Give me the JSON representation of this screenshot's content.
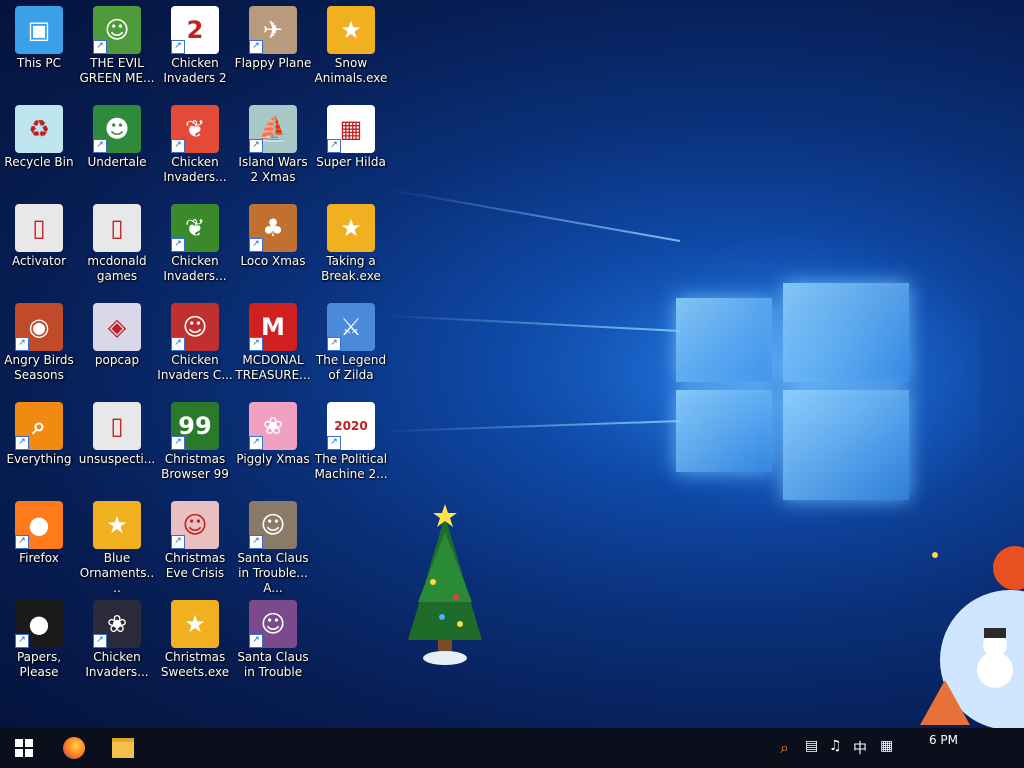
{
  "desktop": {
    "icons": [
      {
        "label": "This PC",
        "glyph": "▣",
        "bg": "#3aa0e8",
        "shortcut": false
      },
      {
        "label": "THE EVIL GREEN ME...",
        "glyph": "☺",
        "bg": "#4f9a3a",
        "shortcut": true
      },
      {
        "label": "Chicken Invaders 2",
        "glyph": "2",
        "bg": "#ffffff",
        "shortcut": true
      },
      {
        "label": "Flappy Plane",
        "glyph": "✈",
        "bg": "#b89a7c",
        "shortcut": true
      },
      {
        "label": "Snow Animals.exe",
        "glyph": "★",
        "bg": "#f0b020",
        "shortcut": false
      },
      {
        "label": "Recycle Bin",
        "glyph": "♻",
        "bg": "#bfe6ee",
        "shortcut": false
      },
      {
        "label": "Undertale",
        "glyph": "☻",
        "bg": "#2f8a3a",
        "shortcut": true
      },
      {
        "label": "Chicken Invaders...",
        "glyph": "❦",
        "bg": "#e34a3a",
        "shortcut": true
      },
      {
        "label": "Island Wars 2 Xmas",
        "glyph": "⛵",
        "bg": "#a8c8c8",
        "shortcut": true
      },
      {
        "label": "Super Hilda",
        "glyph": "▦",
        "bg": "#ffffff",
        "shortcut": true
      },
      {
        "label": "Activator",
        "glyph": "▯",
        "bg": "#e8e8e8",
        "shortcut": false
      },
      {
        "label": "mcdonald games",
        "glyph": "▯",
        "bg": "#e8e8e8",
        "shortcut": false
      },
      {
        "label": "Chicken Invaders...",
        "glyph": "❦",
        "bg": "#3a8a2a",
        "shortcut": true
      },
      {
        "label": "Loco Xmas",
        "glyph": "♣",
        "bg": "#c07030",
        "shortcut": true
      },
      {
        "label": "Taking a Break.exe",
        "glyph": "★",
        "bg": "#f0b020",
        "shortcut": false
      },
      {
        "label": "Angry Birds Seasons",
        "glyph": "◉",
        "bg": "#c04a2a",
        "shortcut": true
      },
      {
        "label": "popcap",
        "glyph": "◈",
        "bg": "#d8d8e8",
        "shortcut": false
      },
      {
        "label": "Chicken Invaders C...",
        "glyph": "☺",
        "bg": "#c03030",
        "shortcut": true
      },
      {
        "label": "MCDONAL TREASURE...",
        "glyph": "M",
        "bg": "#d02020",
        "shortcut": true
      },
      {
        "label": "The Legend of Zilda",
        "glyph": "⚔",
        "bg": "#4a8ad8",
        "shortcut": true
      },
      {
        "label": "Everything",
        "glyph": "⌕",
        "bg": "#f08a10",
        "shortcut": true
      },
      {
        "label": "unsuspecti...",
        "glyph": "▯",
        "bg": "#e8e8e8",
        "shortcut": false
      },
      {
        "label": "Christmas Browser 99",
        "glyph": "99",
        "bg": "#2a7a2a",
        "shortcut": true
      },
      {
        "label": "Piggly Xmas",
        "glyph": "❀",
        "bg": "#f0a0c0",
        "shortcut": true
      },
      {
        "label": "The Political Machine 2...",
        "glyph": "2020",
        "bg": "#ffffff",
        "shortcut": true
      },
      {
        "label": "Firefox",
        "glyph": "●",
        "bg": "#ff7a1a",
        "shortcut": true
      },
      {
        "label": "Blue Ornaments....",
        "glyph": "★",
        "bg": "#f0b020",
        "shortcut": false
      },
      {
        "label": "Christmas Eve Crisis",
        "glyph": "☺",
        "bg": "#e8c0c0",
        "shortcut": true
      },
      {
        "label": "Santa Claus in Trouble... A...",
        "glyph": "☺",
        "bg": "#8a7a6a",
        "shortcut": true
      },
      {
        "label": "Papers, Please",
        "glyph": "●",
        "bg": "#1a1a1a",
        "shortcut": true
      },
      {
        "label": "Chicken Invaders...",
        "glyph": "❀",
        "bg": "#2a2a3a",
        "shortcut": true
      },
      {
        "label": "Christmas Sweets.exe",
        "glyph": "★",
        "bg": "#f0b020",
        "shortcut": false
      },
      {
        "label": "Santa Claus in Trouble",
        "glyph": "☺",
        "bg": "#7a4a8a",
        "shortcut": true
      }
    ]
  },
  "taskbar": {
    "start_icon": "windows-logo",
    "pinned": [
      {
        "name": "firefox",
        "glyph": "●",
        "color": "#ff7a1a"
      },
      {
        "name": "file-explorer",
        "glyph": "■",
        "color": "#f2c14a"
      }
    ],
    "tray": {
      "search_glyph": "⌕",
      "network_glyph": "▤",
      "volume_glyph": "♫",
      "ime": "中",
      "keyboard_glyph": "▦",
      "time": "6 PM"
    }
  }
}
